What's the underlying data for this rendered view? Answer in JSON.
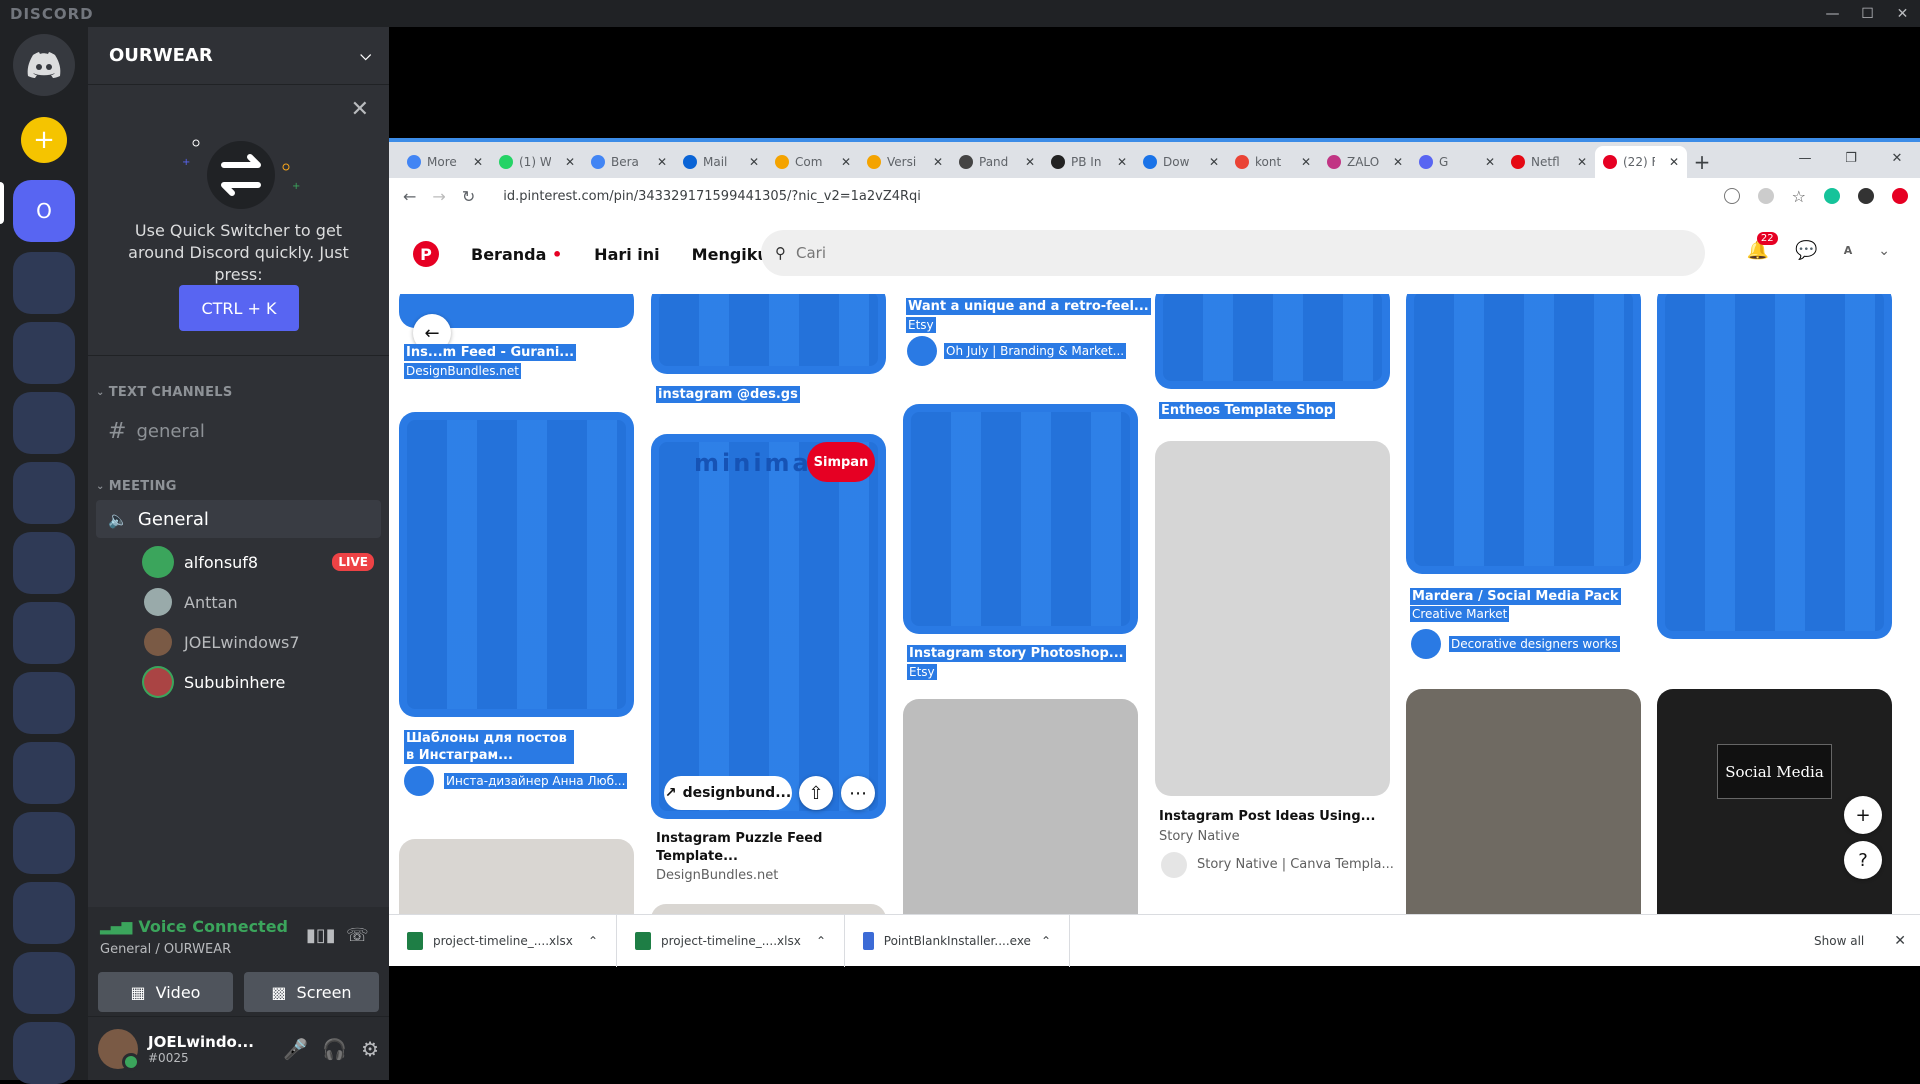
{
  "app": {
    "brand": "DISCORD"
  },
  "window_controls": {
    "minimize": "—",
    "maximize": "☐",
    "close": "✕"
  },
  "server": {
    "name": "OURWEAR"
  },
  "quick_switcher": {
    "text": "Use Quick Switcher to get around Discord quickly. Just press:",
    "shortcut": "CTRL + K"
  },
  "categories": {
    "text": "TEXT CHANNELS",
    "meeting": "MEETING"
  },
  "channels": {
    "general_text": "general",
    "general_voice": "General"
  },
  "voice_users": [
    {
      "name": "alfonsuf8",
      "live": "LIVE"
    },
    {
      "name": "Anttan"
    },
    {
      "name": "JOELwindows7"
    },
    {
      "name": "Sububinhere"
    }
  ],
  "voice_panel": {
    "status": "Voice Connected",
    "location": "General / OURWEAR",
    "video": "Video",
    "screen": "Screen"
  },
  "user": {
    "name": "JOELwindo...",
    "tag": "#0025"
  },
  "browser": {
    "tabs": [
      "More",
      "(1) W",
      "Bera",
      "Mail",
      "Com",
      "Versi",
      "Pand",
      "PB In",
      "Dow",
      "kont",
      "ZALO",
      "G",
      "Netfl",
      "(22) F"
    ],
    "url": "id.pinterest.com/pin/343329171599441305/?nic_v2=1a2vZ4Rqi",
    "downloads": [
      "project-timeline_....xlsx",
      "project-timeline_....xlsx",
      "PointBlankInstaller....exe"
    ],
    "show_all": "Show all"
  },
  "pinterest": {
    "nav": {
      "home": "Beranda",
      "today": "Hari ini",
      "following": "Mengikuti",
      "search_placeholder": "Cari",
      "notif_count": "22"
    },
    "pins": {
      "p1_title": "Ins...m Feed - Gurani...",
      "p1_source": "DesignBundles.net",
      "p2_title": "instagram @des.gs",
      "p3_title": "Want a unique and a retro-feel...",
      "p3_source": "Etsy",
      "p3_user": "Oh July | Branding & Market...",
      "p4_title": "Entheos Template Shop",
      "p5_title": "Шаблоны для постов в Инстаграм...",
      "p5_user": "Инста-дизайнер Анна Люб...",
      "p6_save": "Simpan",
      "p6_link": "designbund...",
      "p6_title": "Instagram Puzzle Feed Template...",
      "p6_source": "DesignBundles.net",
      "p6_word": "minimal",
      "p7_title": "Instagram story Photoshop...",
      "p7_source": "Etsy",
      "p8_title": "Instagram Post Ideas Using...",
      "p8_source": "Story Native",
      "p8_user": "Story Native | Canva Templa...",
      "p9_title": "Mardera / Social Media Pack",
      "p9_source": "Creative Market",
      "p9_user": "Decorative designers works",
      "p10_overlay": "Social Media"
    }
  },
  "colors": {
    "discord_blurple": "#5865f2",
    "voice_green": "#3ba55c",
    "pinterest_red": "#e60023",
    "highlight_blue": "#2a7ae4"
  }
}
